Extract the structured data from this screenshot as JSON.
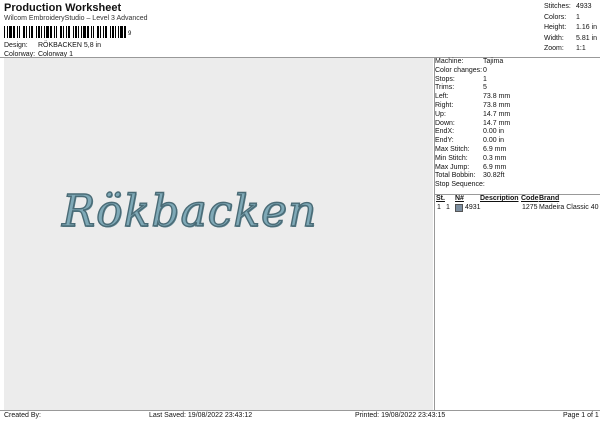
{
  "header": {
    "title": "Production Worksheet",
    "subtitle": "Wilcom EmbroideryStudio – Level 3 Advanced",
    "barcode_digits": "9"
  },
  "meta": {
    "design_label": "Design:",
    "design_value": "RÖKBACKEN 5,8 in",
    "colorway_label": "Colorway:",
    "colorway_value": "Colorway 1"
  },
  "stats": [
    {
      "label": "Stitches:",
      "value": "4933"
    },
    {
      "label": "Colors:",
      "value": "1"
    },
    {
      "label": "Height:",
      "value": "1.16 in"
    },
    {
      "label": "Width:",
      "value": "5.81 in"
    },
    {
      "label": "Zoom:",
      "value": "1:1"
    }
  ],
  "design": {
    "text": "Rökbacken",
    "thread_color": "#7fa9b7"
  },
  "machine": [
    {
      "label": "Machine:",
      "value": "Tajima"
    },
    {
      "label": "Color changes:",
      "value": "0"
    },
    {
      "label": "Stops:",
      "value": "1"
    },
    {
      "label": "Trims:",
      "value": "5"
    },
    {
      "label": "Left:",
      "value": "73.8 mm"
    },
    {
      "label": "Right:",
      "value": "73.8 mm"
    },
    {
      "label": "Up:",
      "value": "14.7 mm"
    },
    {
      "label": "Down:",
      "value": "14.7 mm"
    },
    {
      "label": "EndX:",
      "value": "0.00 in"
    },
    {
      "label": "EndY:",
      "value": "0.00 in"
    },
    {
      "label": "Max Stitch:",
      "value": "6.9 mm"
    },
    {
      "label": "Min Stitch:",
      "value": "0.3 mm"
    },
    {
      "label": "Max Jump:",
      "value": "6.9 mm"
    },
    {
      "label": "Total Bobbin:",
      "value": "30.82ft"
    },
    {
      "label": "Stop Sequence:",
      "value": ""
    }
  ],
  "sequence": {
    "headers": {
      "st": "St.",
      "n": "N#",
      "description": "Description",
      "code": "Code",
      "brand": "Brand"
    },
    "rows": [
      {
        "step": "1",
        "num": "1",
        "swatch_color": "#7d8fa0",
        "stitches": "4931",
        "code": "1275",
        "brand": "Madeira Classic 40"
      }
    ]
  },
  "footer": {
    "created_by": "Created By:",
    "last_saved": "Last Saved: 19/08/2022 23:43:12",
    "printed": "Printed: 19/08/2022 23:43:15",
    "page": "Page 1 of 1"
  }
}
